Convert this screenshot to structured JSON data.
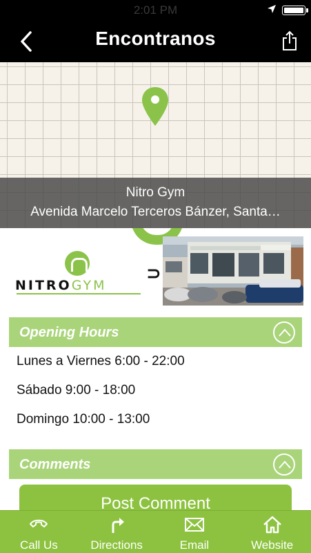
{
  "status_bar": {
    "time": "2:01 PM"
  },
  "nav": {
    "title": "Encontranos",
    "back_icon": "chevron-left-icon",
    "share_icon": "share-icon"
  },
  "map": {
    "place_name": "Nitro Gym",
    "address": "Avenida Marcelo Terceros Bánzer, Santa…"
  },
  "gallery": {
    "logo_word_dark": "NITRO",
    "logo_word_green": "GYM"
  },
  "opening_hours": {
    "title": "Opening Hours",
    "rows": [
      "Lunes a Viernes 6:00 - 22:00",
      "Sábado 9:00 - 18:00",
      "Domingo 10:00 - 13:00"
    ]
  },
  "comments": {
    "title": "Comments",
    "post_button": "Post Comment"
  },
  "tabbar": {
    "items": [
      {
        "label": "Call Us",
        "icon": "phone-icon"
      },
      {
        "label": "Directions",
        "icon": "directions-icon"
      },
      {
        "label": "Email",
        "icon": "mail-icon"
      },
      {
        "label": "Website",
        "icon": "home-icon"
      }
    ]
  },
  "colors": {
    "accent_green": "#8cc23f",
    "section_green": "#a9d47a",
    "map_overlay": "#464646"
  }
}
